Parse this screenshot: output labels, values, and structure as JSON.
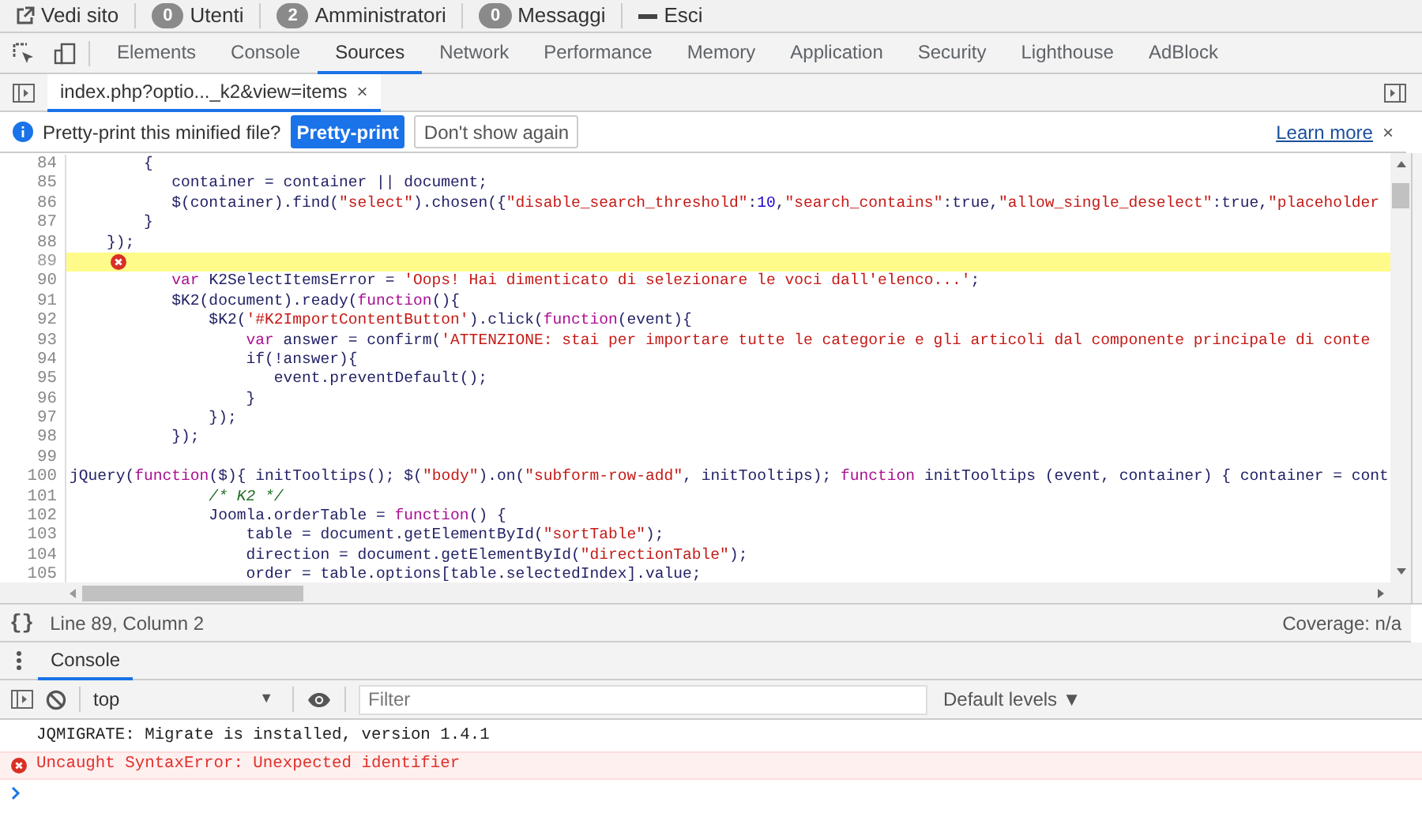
{
  "admin_bar": {
    "items": [
      {
        "kind": "link",
        "label": "Vedi sito"
      },
      {
        "kind": "badge",
        "count": "0",
        "label": "Utenti"
      },
      {
        "kind": "badge",
        "count": "2",
        "label": "Amministratori"
      },
      {
        "kind": "badge",
        "count": "0",
        "label": "Messaggi"
      },
      {
        "kind": "logout",
        "label": "Esci"
      }
    ]
  },
  "devtools_tabs": [
    {
      "label": "Elements",
      "selected": false
    },
    {
      "label": "Console",
      "selected": false
    },
    {
      "label": "Sources",
      "selected": true
    },
    {
      "label": "Network",
      "selected": false
    },
    {
      "label": "Performance",
      "selected": false
    },
    {
      "label": "Memory",
      "selected": false
    },
    {
      "label": "Application",
      "selected": false
    },
    {
      "label": "Security",
      "selected": false
    },
    {
      "label": "Lighthouse",
      "selected": false
    },
    {
      "label": "AdBlock",
      "selected": false
    }
  ],
  "file_tabs": [
    {
      "label": "index.php?optio..._k2&view=items",
      "close": "×",
      "selected": true
    }
  ],
  "infobar": {
    "message": "Pretty-print this minified file?",
    "primary_button": "Pretty-print",
    "secondary_button": "Don't show again",
    "link": "Learn more",
    "close": "×"
  },
  "code_lines": [
    {
      "number": "84",
      "highlighted": false,
      "error": false,
      "tokens": [
        {
          "t": "        {",
          "kind": "plain"
        }
      ]
    },
    {
      "number": "85",
      "highlighted": false,
      "error": false,
      "tokens": [
        {
          "t": "           container = container || document;",
          "kind": "plain"
        }
      ]
    },
    {
      "number": "86",
      "highlighted": false,
      "error": false,
      "tokens": [
        {
          "t": "           $(container).find(",
          "kind": "plain"
        },
        {
          "t": "\"select\"",
          "kind": "string"
        },
        {
          "t": ").chosen({",
          "kind": "plain"
        },
        {
          "t": "\"disable_search_threshold\"",
          "kind": "string"
        },
        {
          "t": ":",
          "kind": "plain"
        },
        {
          "t": "10",
          "kind": "number"
        },
        {
          "t": ",",
          "kind": "plain"
        },
        {
          "t": "\"search_contains\"",
          "kind": "string"
        },
        {
          "t": ":true,",
          "kind": "plain"
        },
        {
          "t": "\"allow_single_deselect\"",
          "kind": "string"
        },
        {
          "t": ":true,",
          "kind": "plain"
        },
        {
          "t": "\"placeholder",
          "kind": "string"
        }
      ]
    },
    {
      "number": "87",
      "highlighted": false,
      "error": false,
      "tokens": [
        {
          "t": "        }",
          "kind": "plain"
        }
      ]
    },
    {
      "number": "88",
      "highlighted": false,
      "error": false,
      "tokens": [
        {
          "t": "    });",
          "kind": "plain"
        }
      ]
    },
    {
      "number": "89",
      "highlighted": true,
      "error": true
    },
    {
      "number": "90",
      "highlighted": false,
      "error": false,
      "tokens": [
        {
          "t": "           var",
          "kind": "keyword"
        },
        {
          "t": " K2SelectItemsError = ",
          "kind": "plain"
        },
        {
          "t": "'Oops! Hai dimenticato di selezionare le voci dall'elenco...'",
          "kind": "string"
        },
        {
          "t": ";",
          "kind": "plain"
        }
      ]
    },
    {
      "number": "91",
      "highlighted": false,
      "error": false,
      "tokens": [
        {
          "t": "           $K2(document).ready(",
          "kind": "plain"
        },
        {
          "t": "function",
          "kind": "keyword"
        },
        {
          "t": "(){",
          "kind": "plain"
        }
      ]
    },
    {
      "number": "92",
      "highlighted": false,
      "error": false,
      "tokens": [
        {
          "t": "               $K2(",
          "kind": "plain"
        },
        {
          "t": "'#K2ImportContentButton'",
          "kind": "string"
        },
        {
          "t": ").click(",
          "kind": "plain"
        },
        {
          "t": "function",
          "kind": "keyword"
        },
        {
          "t": "(event){",
          "kind": "plain"
        }
      ]
    },
    {
      "number": "93",
      "highlighted": false,
      "error": false,
      "tokens": [
        {
          "t": "                   var",
          "kind": "keyword"
        },
        {
          "t": " answer = confirm(",
          "kind": "plain"
        },
        {
          "t": "'ATTENZIONE: stai per importare tutte le categorie e gli articoli dal componente principale di conte",
          "kind": "string"
        }
      ]
    },
    {
      "number": "94",
      "highlighted": false,
      "error": false,
      "tokens": [
        {
          "t": "                   if(!answer){",
          "kind": "plain"
        }
      ]
    },
    {
      "number": "95",
      "highlighted": false,
      "error": false,
      "tokens": [
        {
          "t": "                      event.preventDefault();",
          "kind": "plain"
        }
      ]
    },
    {
      "number": "96",
      "highlighted": false,
      "error": false,
      "tokens": [
        {
          "t": "                   }",
          "kind": "plain"
        }
      ]
    },
    {
      "number": "97",
      "highlighted": false,
      "error": false,
      "tokens": [
        {
          "t": "               });",
          "kind": "plain"
        }
      ]
    },
    {
      "number": "98",
      "highlighted": false,
      "error": false,
      "tokens": [
        {
          "t": "           });",
          "kind": "plain"
        }
      ]
    },
    {
      "number": "99",
      "highlighted": false,
      "error": false
    },
    {
      "number": "100",
      "highlighted": false,
      "error": false,
      "tokens": [
        {
          "t": "jQuery(",
          "kind": "plain"
        },
        {
          "t": "function",
          "kind": "keyword"
        },
        {
          "t": "($){ initTooltips(); $(",
          "kind": "plain"
        },
        {
          "t": "\"body\"",
          "kind": "string"
        },
        {
          "t": ").on(",
          "kind": "plain"
        },
        {
          "t": "\"subform-row-add\"",
          "kind": "string"
        },
        {
          "t": ", initTooltips); ",
          "kind": "plain"
        },
        {
          "t": "function",
          "kind": "keyword"
        },
        {
          "t": " initTooltips (event, container) { container = cont",
          "kind": "plain"
        }
      ]
    },
    {
      "number": "101",
      "highlighted": false,
      "error": false,
      "tokens": [
        {
          "t": "               /* K2 */",
          "kind": "comment"
        }
      ]
    },
    {
      "number": "102",
      "highlighted": false,
      "error": false,
      "tokens": [
        {
          "t": "               Joomla.orderTable = ",
          "kind": "plain"
        },
        {
          "t": "function",
          "kind": "keyword"
        },
        {
          "t": "() {",
          "kind": "plain"
        }
      ]
    },
    {
      "number": "103",
      "highlighted": false,
      "error": false,
      "tokens": [
        {
          "t": "                   table = document.getElementById(",
          "kind": "plain"
        },
        {
          "t": "\"sortTable\"",
          "kind": "string"
        },
        {
          "t": ");",
          "kind": "plain"
        }
      ]
    },
    {
      "number": "104",
      "highlighted": false,
      "error": false,
      "tokens": [
        {
          "t": "                   direction = document.getElementById(",
          "kind": "plain"
        },
        {
          "t": "\"directionTable\"",
          "kind": "string"
        },
        {
          "t": ");",
          "kind": "plain"
        }
      ]
    },
    {
      "number": "105",
      "highlighted": false,
      "error": false,
      "tokens": [
        {
          "t": "                   order = table.options[table.selectedIndex].value;",
          "kind": "plain"
        }
      ]
    }
  ],
  "status_bar": {
    "format_button": "{}",
    "position": "Line 89, Column 2",
    "coverage": "Coverage: n/a"
  },
  "drawer_tabs": [
    {
      "label": "Console",
      "selected": true
    }
  ],
  "console_toolbar": {
    "context": "top",
    "context_caret": "▼",
    "filter_placeholder": "Filter",
    "levels": "Default levels ▼"
  },
  "console_messages": [
    {
      "kind": "log",
      "text": "JQMIGRATE: Migrate is installed, version 1.4.1"
    },
    {
      "kind": "error",
      "text": "Uncaught SyntaxError: Unexpected identifier"
    }
  ]
}
